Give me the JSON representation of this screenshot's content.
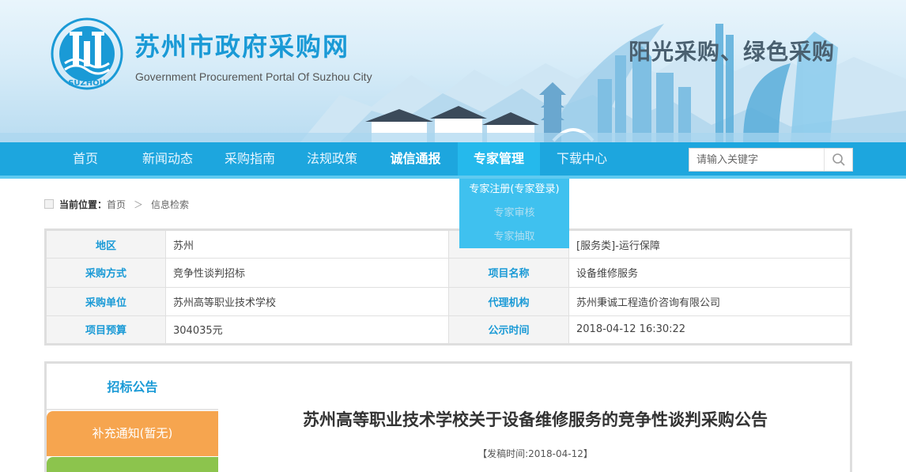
{
  "header": {
    "title": "苏州市政府采购网",
    "subtitle": "Government Procurement Portal Of Suzhou City",
    "slogan": "阳光采购、绿色采购",
    "logo_text": "SUZHOU"
  },
  "nav": {
    "items": [
      {
        "label": "首页"
      },
      {
        "label": "新闻动态"
      },
      {
        "label": "采购指南"
      },
      {
        "label": "法规政策"
      },
      {
        "label": "诚信通报"
      },
      {
        "label": "专家管理"
      },
      {
        "label": "下载中心"
      }
    ],
    "active_index": 5,
    "search_placeholder": "请输入关键字",
    "search_icon": "search-icon"
  },
  "dropdown": {
    "items": [
      {
        "label": "专家注册(专家登录)"
      },
      {
        "label": "专家审核"
      },
      {
        "label": "专家抽取"
      }
    ]
  },
  "breadcrumb": {
    "label": "当前位置：",
    "items": [
      "首页",
      "信息检索"
    ],
    "separator": "＞"
  },
  "info": {
    "rows": [
      {
        "l1": "地区",
        "v1": "苏州",
        "l2": "",
        "v2": "[服务类]-运行保障"
      },
      {
        "l1": "采购方式",
        "v1": "竞争性谈判招标",
        "l2": "项目名称",
        "v2": "设备维修服务"
      },
      {
        "l1": "采购单位",
        "v1": "苏州高等职业技术学校",
        "l2": "代理机构",
        "v2": "苏州秉诚工程造价咨询有限公司"
      },
      {
        "l1": "项目预算",
        "v1": "304035元",
        "l2": "公示时间",
        "v2": "2018-04-12 16:30:22"
      }
    ]
  },
  "sidebar": {
    "tabs": [
      {
        "label": "招标公告"
      },
      {
        "label": "补充通知(暂无)"
      },
      {
        "label": ""
      }
    ]
  },
  "article": {
    "title": "苏州高等职业技术学校关于设备维修服务的竞争性谈判采购公告",
    "meta": "【发稿时间:2018-04-12】"
  },
  "colors": {
    "brand_blue": "#1a9ad6",
    "nav_blue": "#1da6de",
    "orange_tab": "#f6a54f",
    "green_tab": "#8cc44d"
  }
}
